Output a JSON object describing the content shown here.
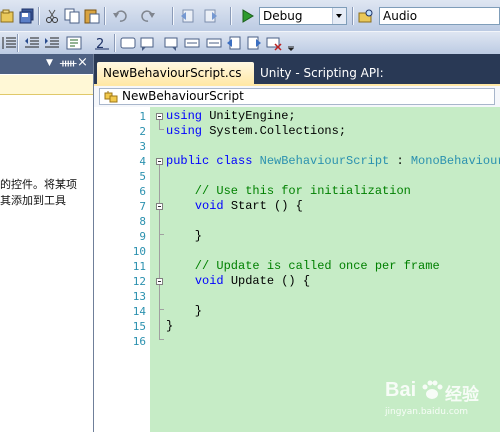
{
  "toolbar": {
    "config_combo": "Debug",
    "search_combo": "Audio"
  },
  "left_panel": {
    "line1": "的控件。将某项",
    "line2": "其添加到工具"
  },
  "tabs": {
    "active_label": "NewBehaviourScript.cs",
    "inactive_label": "Unity - Scripting API:"
  },
  "nav": {
    "class_combo": "NewBehaviourScript"
  },
  "editor": {
    "line_numbers": [
      "1",
      "2",
      "3",
      "4",
      "5",
      "6",
      "7",
      "8",
      "9",
      "10",
      "11",
      "12",
      "13",
      "14",
      "15",
      "16"
    ],
    "code": {
      "l1_kw": "using",
      "l1_rest": " UnityEngine;",
      "l2_kw": "using",
      "l2_rest": " System.Collections;",
      "l4_kw": "public class",
      "l4_sp": " ",
      "l4_type": "NewBehaviourScript",
      "l4_colon": " : ",
      "l4_base": "MonoBehaviour",
      "l4_brace": " {",
      "l6_comment": "    // Use this for initialization",
      "l7_indent": "    ",
      "l7_kw": "void",
      "l7_rest": " Start () {",
      "l9_text": "    }",
      "l11_comment": "    // Update is called once per frame",
      "l12_indent": "    ",
      "l12_kw": "void",
      "l12_rest": " Update () {",
      "l14_text": "    }",
      "l15_text": "}"
    }
  },
  "watermark": {
    "brand": "Bai",
    "brand_cn": "经验",
    "url": "jingyan.baidu.com"
  },
  "colors": {
    "code_background": "#c6ecc6",
    "keyword": "#0000ff",
    "type": "#2b91af",
    "comment": "#008000",
    "active_tab": "#ffe8a6",
    "chrome_dark": "#293955"
  }
}
